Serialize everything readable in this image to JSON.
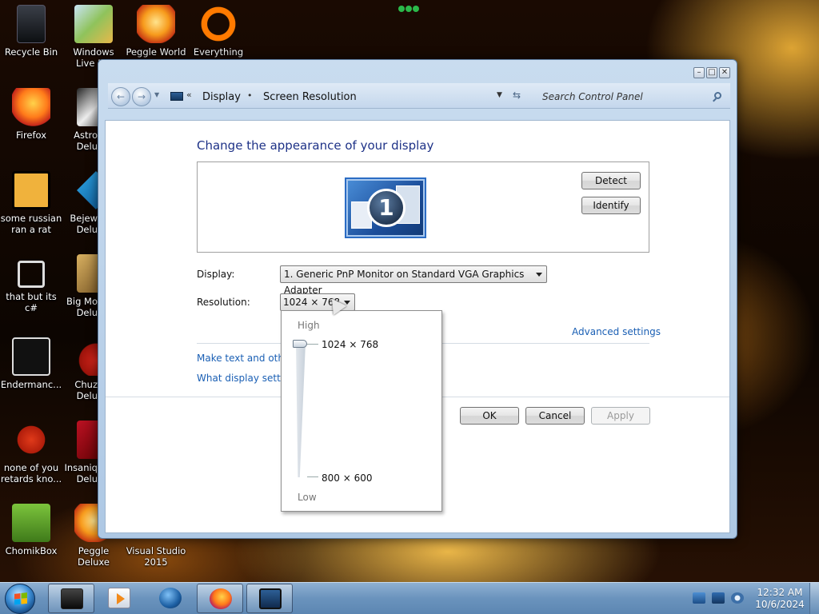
{
  "desktop": {
    "icons": [
      {
        "label": "Recycle Bin"
      },
      {
        "label": "Windows Live Ma"
      },
      {
        "label": "Peggle World"
      },
      {
        "label": "Everything"
      },
      {
        "label": "Firefox"
      },
      {
        "label": "Astro Delu"
      },
      {
        "label": "some russian ran a rat"
      },
      {
        "label": "Bejew Delu"
      },
      {
        "label": "that but its c#"
      },
      {
        "label": "Big Mo Delu"
      },
      {
        "label": "Endermanc..."
      },
      {
        "label": "Chuz Delu"
      },
      {
        "label": "none of you retards kno..."
      },
      {
        "label": "Insaniq Delu"
      },
      {
        "label": "ChomikBox"
      },
      {
        "label": "Peggle Deluxe"
      },
      {
        "label": "Visual Studio 2015"
      }
    ]
  },
  "window": {
    "breadcrumb": [
      "Display",
      "Screen Resolution"
    ],
    "crumb_chevrons": "«",
    "crumb_dot": "•",
    "search_placeholder": "Search Control Panel",
    "title_controls": {
      "minimize": "–",
      "maximize": "□",
      "close": "✕"
    },
    "page_title": "Change the appearance of your display",
    "monitor_number": "1",
    "buttons": {
      "detect": "Detect",
      "identify": "Identify",
      "ok": "OK",
      "cancel": "Cancel",
      "apply": "Apply"
    },
    "display_label": "Display:",
    "display_value": "1. Generic PnP Monitor on Standard VGA Graphics Adapter",
    "resolution_label": "Resolution:",
    "resolution_value": "1024 × 768",
    "advanced_link": "Advanced settings",
    "link_text_size": "Make text and other",
    "link_display_settings": "What display setting",
    "resolution_popup": {
      "high_label": "High",
      "low_label": "Low",
      "options": [
        "1024 × 768",
        "800 × 600"
      ],
      "selected_fraction": 1.0
    }
  },
  "taskbar": {
    "clock_time": "12:32 AM",
    "clock_date": "10/6/2024"
  },
  "colors": {
    "title_blue": "#1e3287",
    "link_blue": "#1a5fb4",
    "taskbar": "#6a93bd"
  }
}
